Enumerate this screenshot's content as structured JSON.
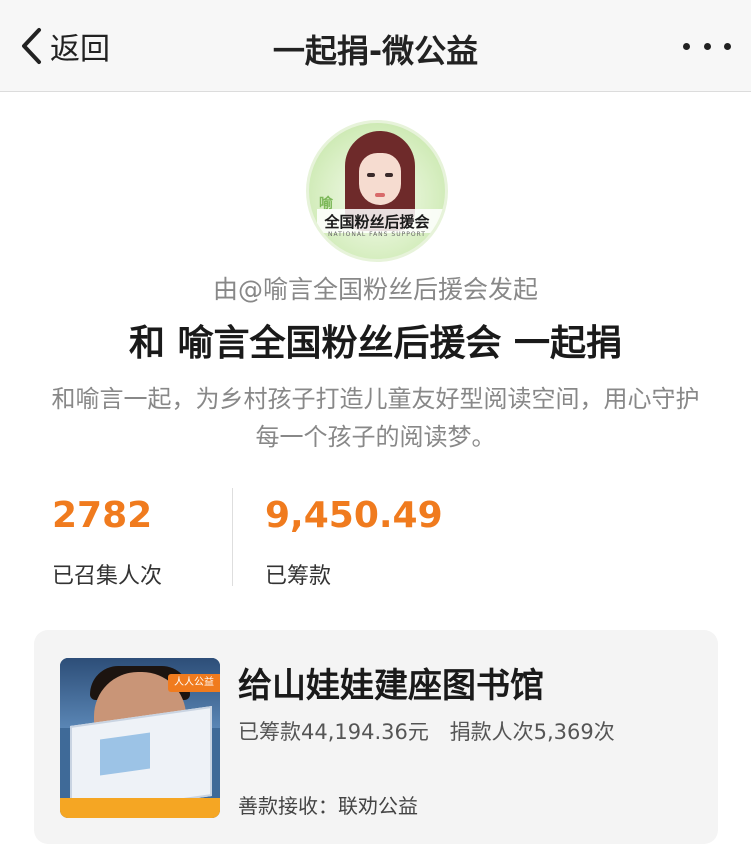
{
  "navbar": {
    "back_label": "返回",
    "title": "一起捐-微公益",
    "more_icon": "more-dots-icon"
  },
  "avatar": {
    "ring_text": "喻",
    "banner_text": "全国粉丝后援会",
    "sub_text": "NATIONAL FANS SUPPORT"
  },
  "project": {
    "initiator": "由@喻言全国粉丝后援会发起",
    "headline": "和 喻言全国粉丝后援会 一起捐",
    "description": "和喻言一起，为乡村孩子打造儿童友好型阅读空间，用心守护每一个孩子的阅读梦。"
  },
  "stats": {
    "participants_value": "2782",
    "participants_label": "已召集人次",
    "raised_value": "9,450.49",
    "raised_label": "已筹款"
  },
  "campaign_card": {
    "title": "给山娃娃建座图书馆",
    "raised_text": "已筹款44,194.36元",
    "donors_text": "捐款人次5,369次",
    "recipient_text": "善款接收：联劝公益",
    "image_badge": "人人公益"
  },
  "colors": {
    "accent": "#f07b1e",
    "navbar_bg": "#f7f7f7",
    "card_bg": "#f4f4f4",
    "muted_text": "#888888"
  }
}
